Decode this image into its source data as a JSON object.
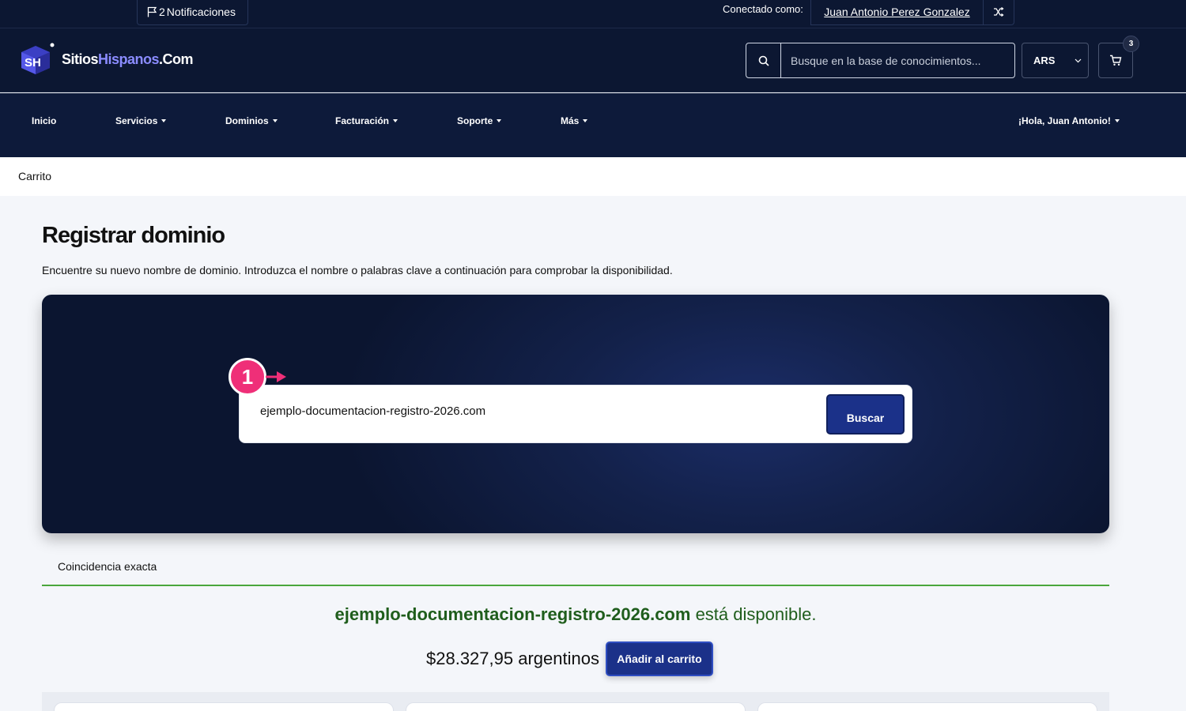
{
  "topbar": {
    "notifications_count": "2",
    "notifications_label": "Notificaciones",
    "logged_in_label": "Conectado como:",
    "user_name": "Juan Antonio Perez Gonzalez"
  },
  "header": {
    "logo_part1": "Sitios",
    "logo_part2": "Hispanos",
    "logo_part3": ".Com",
    "search_placeholder": "Busque en la base de conocimientos...",
    "currency": "ARS",
    "cart_count": "3"
  },
  "nav": {
    "items": [
      "Inicio",
      "Servicios",
      "Dominios",
      "Facturación",
      "Soporte",
      "Más"
    ],
    "greeting": "¡Hola, Juan Antonio!"
  },
  "breadcrumb": "Carrito",
  "page": {
    "title": "Registrar dominio",
    "intro": "Encuentre su nuevo nombre de dominio. Introduzca el nombre o palabras clave a continuación para comprobar la disponibilidad."
  },
  "search": {
    "domain_value": "ejemplo-documentacion-registro-2026.com",
    "button_label": "Buscar",
    "step_number": "1"
  },
  "result": {
    "match_label": "Coincidencia exacta",
    "domain": "ejemplo-documentacion-registro-2026.com",
    "status_text": "está disponible.",
    "price": "$28.327,95 argentinos",
    "add_to_cart_label": "Añadir al carrito"
  },
  "colors": {
    "navy": "#0c1732",
    "primary_button": "#1b3189",
    "available_green": "#1f5d1c",
    "step_marker": "#ef2f78"
  }
}
